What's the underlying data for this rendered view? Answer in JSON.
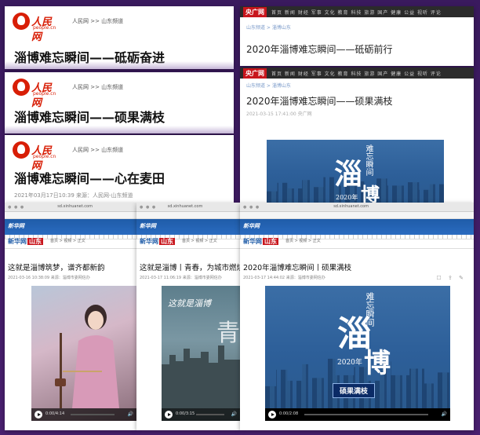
{
  "people_cards": [
    {
      "logo": "人民网",
      "logo_sub": "people.cn",
      "crumb": "人民网 >> 山东频道",
      "title": "淄博难忘瞬间——砥砺奋进",
      "meta": ""
    },
    {
      "logo": "人民网",
      "logo_sub": "people.cn",
      "crumb": "人民网 >> 山东频道",
      "title": "淄博难忘瞬间——硕果满枝",
      "meta": ""
    },
    {
      "logo": "人民网",
      "logo_sub": "people.cn",
      "crumb": "人民网 >> 山东频道",
      "title": "淄博难忘瞬间——心在麦田",
      "meta": "2021年03月17日10:39  来源：人民网-山东频道"
    }
  ],
  "cnr_cards": [
    {
      "logo": "央广网",
      "nav": "首页 新闻 财经 军事 文化 教育 科技 旅游 国产 健康 公益 视听 评论",
      "crumb": "山东频道 > 淄博山东",
      "title": "2020年淄博难忘瞬间——砥砺前行",
      "meta": ""
    },
    {
      "logo": "央广网",
      "nav": "首页 新闻 财经 军事 文化 教育 科技 旅游 国产 健康 公益 视听 评论",
      "crumb": "山东频道 > 淄博山东",
      "title": "2020年淄博难忘瞬间——硕果满枝",
      "meta": "2021-03-15 17:41:00  央广网"
    }
  ],
  "poster": {
    "big": "淄",
    "big2": "博",
    "vert": "难忘瞬间",
    "year": "2020年",
    "ribbon": "硕果满枝"
  },
  "xinhua_cards": [
    {
      "url": "sd.xinhuanet.com",
      "logo": "新华网",
      "brand": "新华网",
      "brand_sd": "山东",
      "crumb": "首页 > 视频 > 正文",
      "title": "这就是淄博筑梦，谱齐都新韵",
      "meta": "2021-03-16 10:38:09  来源：淄博市委网信办",
      "time": "0:00/4:14",
      "vol": "🔊"
    },
    {
      "url": "sd.xinhuanet.com",
      "logo": "新华网",
      "brand": "新华网",
      "brand_sd": "山东",
      "crumb": "首页 > 视频 > 正文",
      "title": "这就是淄博丨青春，为城市燃烧",
      "meta": "2021-03-17 11:06:19  来源：淄博市委网信办",
      "time": "0:00/3:15",
      "vol": "🔊"
    },
    {
      "url": "sd.xinhuanet.com",
      "logo": "新华网",
      "brand": "新华网",
      "brand_sd": "山东",
      "crumb": "首页 > 视频 > 正文",
      "title": "2020年淄博难忘瞬间丨硕果满枝",
      "meta": "2021-03-17 14:44:02  来源：淄博市委网信办",
      "time": "0:00/2:08",
      "vol": "🔊"
    }
  ]
}
